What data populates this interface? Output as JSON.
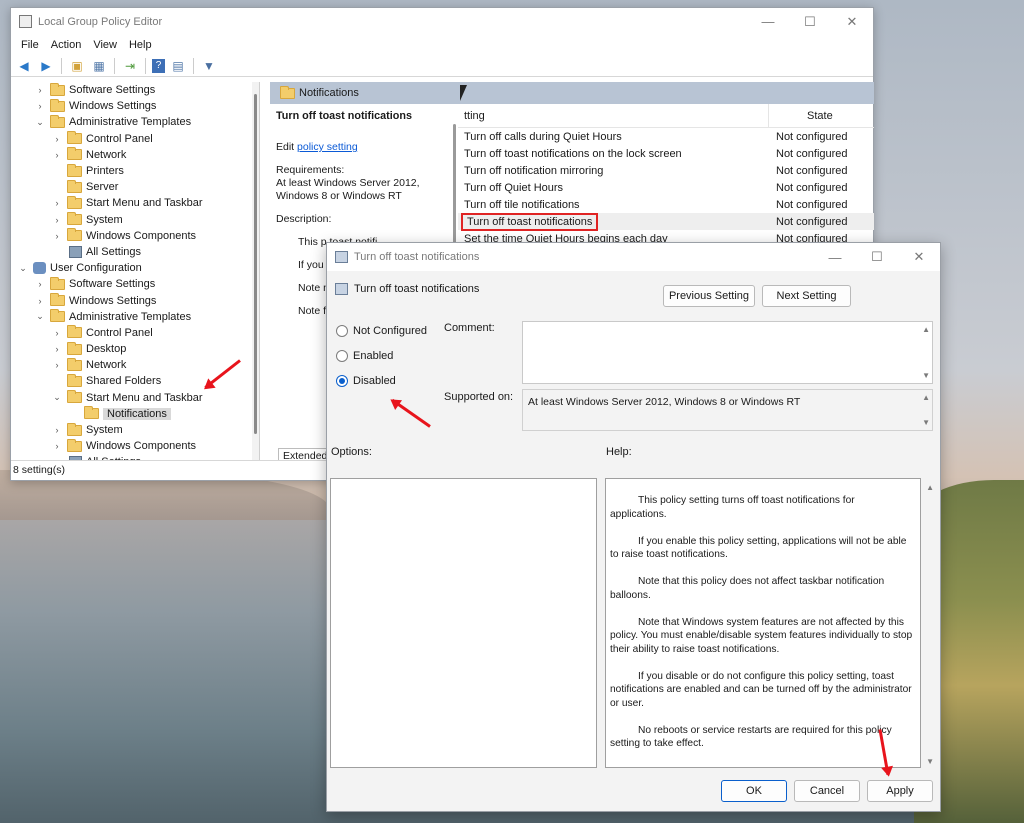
{
  "window": {
    "title": "Local Group Policy Editor",
    "menu": [
      "File",
      "Action",
      "View",
      "Help"
    ]
  },
  "tree": {
    "items": [
      {
        "label": "Software Settings",
        "indent": 1,
        "chev": "›",
        "icon": "folder"
      },
      {
        "label": "Windows Settings",
        "indent": 1,
        "chev": "›",
        "icon": "folder"
      },
      {
        "label": "Administrative Templates",
        "indent": 1,
        "chev": "⌄",
        "icon": "folder"
      },
      {
        "label": "Control Panel",
        "indent": 2,
        "chev": "›",
        "icon": "folder"
      },
      {
        "label": "Network",
        "indent": 2,
        "chev": "›",
        "icon": "folder"
      },
      {
        "label": "Printers",
        "indent": 2,
        "chev": "",
        "icon": "folder"
      },
      {
        "label": "Server",
        "indent": 2,
        "chev": "",
        "icon": "folder"
      },
      {
        "label": "Start Menu and Taskbar",
        "indent": 2,
        "chev": "›",
        "icon": "folder"
      },
      {
        "label": "System",
        "indent": 2,
        "chev": "›",
        "icon": "folder"
      },
      {
        "label": "Windows Components",
        "indent": 2,
        "chev": "›",
        "icon": "folder"
      },
      {
        "label": "All Settings",
        "indent": 2,
        "chev": "",
        "icon": "settings"
      },
      {
        "label": "User Configuration",
        "indent": 0,
        "chev": "⌄",
        "icon": "user"
      },
      {
        "label": "Software Settings",
        "indent": 1,
        "chev": "›",
        "icon": "folder"
      },
      {
        "label": "Windows Settings",
        "indent": 1,
        "chev": "›",
        "icon": "folder"
      },
      {
        "label": "Administrative Templates",
        "indent": 1,
        "chev": "⌄",
        "icon": "folder"
      },
      {
        "label": "Control Panel",
        "indent": 2,
        "chev": "›",
        "icon": "folder"
      },
      {
        "label": "Desktop",
        "indent": 2,
        "chev": "›",
        "icon": "folder"
      },
      {
        "label": "Network",
        "indent": 2,
        "chev": "›",
        "icon": "folder"
      },
      {
        "label": "Shared Folders",
        "indent": 2,
        "chev": "",
        "icon": "folder"
      },
      {
        "label": "Start Menu and Taskbar",
        "indent": 2,
        "chev": "⌄",
        "icon": "folder"
      },
      {
        "label": "Notifications",
        "indent": 3,
        "chev": "",
        "icon": "folder",
        "selected": true
      },
      {
        "label": "System",
        "indent": 2,
        "chev": "›",
        "icon": "folder"
      },
      {
        "label": "Windows Components",
        "indent": 2,
        "chev": "›",
        "icon": "folder"
      },
      {
        "label": "All Settings",
        "indent": 2,
        "chev": "",
        "icon": "settings"
      }
    ]
  },
  "rightpane": {
    "header": "Notifications",
    "desc": {
      "heading": "Turn off toast notifications",
      "edit_prefix": "Edit ",
      "edit_link": "policy setting",
      "req_label": "Requirements:",
      "req_text": "At least Windows Server 2012, Windows 8 or Windows RT",
      "desc_label": "Description:",
      "para1": "This p toast notifi",
      "para2": "If you setting, app able to raise",
      "para3": "Note not affect t balloons.",
      "para4": "Note features are policy. You",
      "extended_tab": "Extended"
    },
    "list": {
      "col_setting": "tting",
      "col_state": "State",
      "rows": [
        {
          "setting": "Turn off calls during Quiet Hours",
          "state": "Not configured"
        },
        {
          "setting": "Turn off toast notifications on the lock screen",
          "state": "Not configured"
        },
        {
          "setting": "Turn off notification mirroring",
          "state": "Not configured"
        },
        {
          "setting": "Turn off Quiet Hours",
          "state": "Not configured"
        },
        {
          "setting": "Turn off tile notifications",
          "state": "Not configured"
        },
        {
          "setting": "Turn off toast notifications",
          "state": "Not configured",
          "highlight": true
        },
        {
          "setting": "Set the time Quiet Hours begins each day",
          "state": "Not configured"
        }
      ]
    },
    "status": "8 setting(s)"
  },
  "dialog": {
    "title": "Turn off toast notifications",
    "subtitle": "Turn off toast notifications",
    "prev": "Previous Setting",
    "next": "Next Setting",
    "radio_not_configured": "Not Configured",
    "radio_enabled": "Enabled",
    "radio_disabled": "Disabled",
    "selected": "Disabled",
    "comment_label": "Comment:",
    "supported_label": "Supported on:",
    "supported_value": "At least Windows Server 2012, Windows 8 or Windows RT",
    "options_label": "Options:",
    "help_label": "Help:",
    "help": [
      "This policy setting turns off toast notifications for applications.",
      "If you enable this policy setting, applications will not be able to raise toast notifications.",
      "Note that this policy does not affect taskbar notification balloons.",
      "Note that Windows system features are not affected by this policy.  You must enable/disable system features individually to stop their ability to raise toast notifications.",
      "If you disable or do not configure this policy setting, toast notifications are enabled and can be turned off by the administrator or user.",
      "No reboots or service restarts are required for this policy setting to take effect."
    ],
    "ok": "OK",
    "cancel": "Cancel",
    "apply": "Apply"
  },
  "colors": {
    "annotation": "#e8141c",
    "selection_blue": "#0a5fcc"
  }
}
